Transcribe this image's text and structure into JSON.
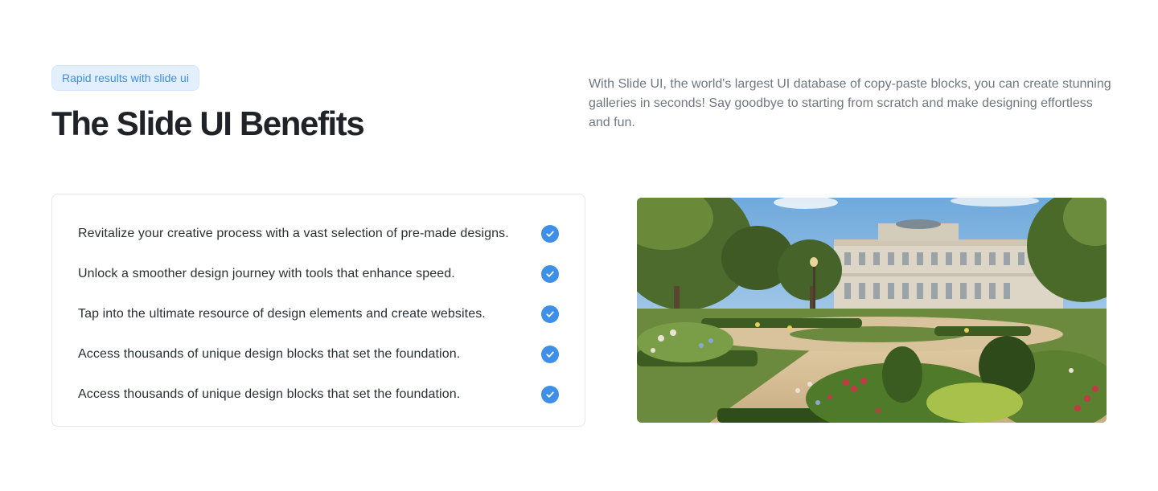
{
  "header": {
    "badge": "Rapid results with slide ui",
    "title": "The Slide UI Benefits",
    "description": "With Slide UI, the world's largest UI database of copy-paste blocks, you can create stunning galleries in seconds! Say goodbye to starting from scratch and make designing effortless and fun."
  },
  "benefits": [
    {
      "text": "Revitalize your creative process with a vast selection of pre-made designs.",
      "icon": "check-circle-icon"
    },
    {
      "text": "Unlock a smoother design journey with tools that enhance speed.",
      "icon": "check-circle-icon"
    },
    {
      "text": "Tap into the ultimate resource of design elements and create websites.",
      "icon": "check-circle-icon"
    },
    {
      "text": "Access thousands of unique design blocks that set the foundation.",
      "icon": "check-circle-icon"
    },
    {
      "text": "Access thousands of unique design blocks that set the foundation.",
      "icon": "check-circle-icon"
    }
  ],
  "colors": {
    "accent": "#3e8fe8",
    "badge_bg": "#e3effd",
    "badge_text": "#3d8fe0"
  }
}
